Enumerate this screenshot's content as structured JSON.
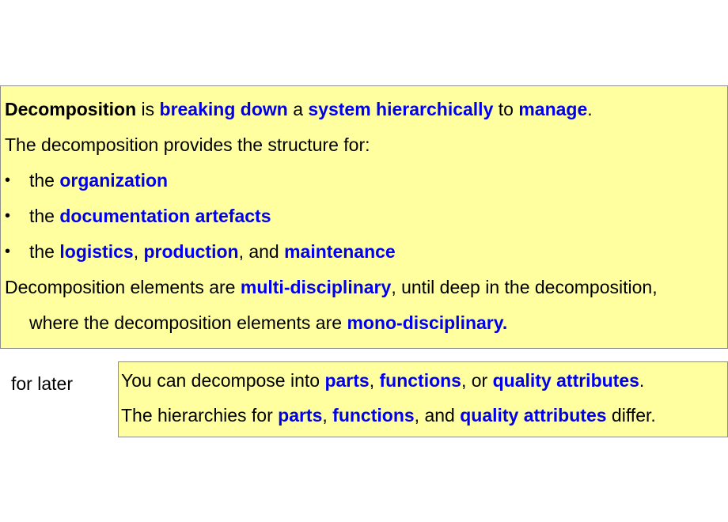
{
  "main": {
    "line1": {
      "term": "Decomposition",
      "t1": " is ",
      "k1": "breaking down",
      "t2": " a ",
      "k2": "system hierarchically",
      "t3": " to ",
      "k3": "manage",
      "t4": "."
    },
    "line2": "The decomposition provides the structure for:",
    "bullet_glyph": "•",
    "bullets": [
      {
        "lead": "the ",
        "k1": "organization"
      },
      {
        "lead": "the ",
        "k1": "documentation artefacts"
      },
      {
        "lead": "the ",
        "k1": "logistics",
        "s1": ", ",
        "k2": "production",
        "s2": ", and ",
        "k3": "maintenance"
      }
    ],
    "line6": {
      "t1": "Decomposition elements are ",
      "k1": "multi-disciplinary",
      "t2": ", until deep in the decomposition,"
    },
    "line7": {
      "t1": "where the decomposition elements are ",
      "k1": "mono-disciplinary."
    }
  },
  "side_note": "for later",
  "later": {
    "line1": {
      "t1": "You can decompose into ",
      "k1": "parts",
      "s1": ", ",
      "k2": "functions",
      "s2": ", or ",
      "k3": "quality attributes",
      "t2": "."
    },
    "line2": {
      "t1": "The hierarchies for ",
      "k1": "parts",
      "s1": ", ",
      "k2": "functions",
      "s2": ", and ",
      "k3": "quality attributes",
      "t2": " differ."
    }
  },
  "colors": {
    "box_fill": "#ffffa0",
    "box_border": "#8c8c8c",
    "keyword": "#0000ee",
    "text": "#000000"
  }
}
